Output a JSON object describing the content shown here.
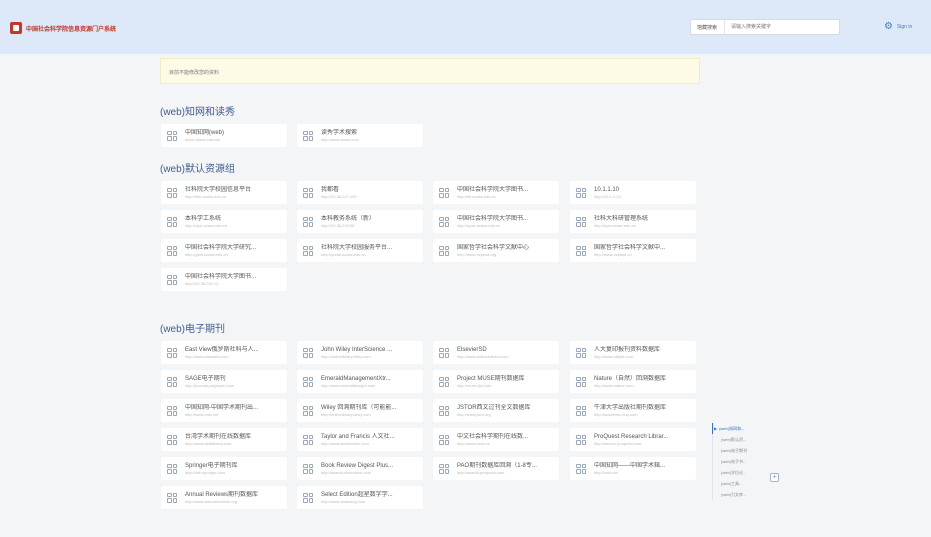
{
  "header": {
    "logo_text": "中国社会科学院信息资源门户系统",
    "search": {
      "scope_label": "馆藏搜索",
      "placeholder": "请输入搜索关键字"
    },
    "user_label": "Sign in"
  },
  "notice": "目前不能修改您的资料",
  "sections": [
    {
      "title": "(web)知网和读秀",
      "items": [
        {
          "name": "中国知网(web)",
          "url": "https://www.cnki.net"
        },
        {
          "name": "读秀学术搜索",
          "url": "http://www.duxiu.com"
        }
      ]
    },
    {
      "title": "(web)默认资源组",
      "items": [
        {
          "name": "社科院大学校园信息平台",
          "url": "http://info.ucass.edu.cn"
        },
        {
          "name": "我都看",
          "url": "http://10.38.247.192"
        },
        {
          "name": "中国社会科学院大学图书...",
          "url": "http://lib.ucass.edu.cn"
        },
        {
          "name": "10.1.1.10",
          "url": "http://10.1.1.10"
        },
        {
          "name": "本科学工系统",
          "url": "http://xgxt.ucass.edu.cn"
        },
        {
          "name": "本科教务系统（新）",
          "url": "http://10.38.220.58"
        },
        {
          "name": "中国社会科学院大学图书...",
          "url": "http://opac.ucass.edu.cn"
        },
        {
          "name": "社科大科研管理系统",
          "url": "http://kyxt.ucass.edu.cn"
        },
        {
          "name": "中国社会科学院大学研究...",
          "url": "http://yjsxt.ucass.edu.cn"
        },
        {
          "name": "社科院大学校园服务平台...",
          "url": "http://portal.ucass.edu.cn"
        },
        {
          "name": "国家哲学社会科学文献中心",
          "url": "http://www.ncpssd.org"
        },
        {
          "name": "国家哲学社会科学文献中...",
          "url": "http://www.ncpssd.cn"
        },
        {
          "name": "中国社会科学院大学图书...",
          "url": "http://10.38.240.12"
        }
      ]
    },
    {
      "title": "(web)电子期刊",
      "items": [
        {
          "name": "East View俄罗斯社科与人...",
          "url": "http://www.eastview.com"
        },
        {
          "name": "John Wiley InterScience ...",
          "url": "http://onlinelibrary.wiley.com"
        },
        {
          "name": "ElsevierSD",
          "url": "http://www.sciencedirect.com"
        },
        {
          "name": "人大复印报刊资料数据库",
          "url": "http://www.rdfybk.com"
        },
        {
          "name": "SAGE电子期刊",
          "url": "http://journals.sagepub.com"
        },
        {
          "name": "EmeraldManagementXtr...",
          "url": "http://www.emeraldinsight.com"
        },
        {
          "name": "Project MUSE期刊数据库",
          "url": "http://muse.jhu.edu"
        },
        {
          "name": "Nature（自然）回溯数据库",
          "url": "http://www.nature.com"
        },
        {
          "name": "中国知网-中国学术期刊出...",
          "url": "http://www.cnki.net"
        },
        {
          "name": "Wiley 回溯期刊库（可能能...",
          "url": "http://onlinelibrary.wiley.com"
        },
        {
          "name": "JSTOR西文过刊全文数据库",
          "url": "http://www.jstor.org"
        },
        {
          "name": "牛津大学出版社期刊数据库",
          "url": "http://academic.oup.com"
        },
        {
          "name": "台湾学术期刊在线数据库",
          "url": "http://www.airitilibrary.com"
        },
        {
          "name": "Taylor and Francis 人文社...",
          "url": "http://www.tandfonline.com"
        },
        {
          "name": "中文社会科学期刊在线数...",
          "url": "http://www.cssn.cn"
        },
        {
          "name": "ProQuest Research Librar...",
          "url": "http://search.proquest.com"
        },
        {
          "name": "Springer电子期刊库",
          "url": "http://link.springer.com"
        },
        {
          "name": "Book Review Digest Plus...",
          "url": "http://search.ebscohost.com"
        },
        {
          "name": "PAO期刊数据库回溯（1-8专...",
          "url": "http://search.proquest.com"
        },
        {
          "name": "中国知网——中国学术辑...",
          "url": "http://cnki.net"
        },
        {
          "name": "Annual Reviews期刊数据库",
          "url": "http://www.annualreviews.org"
        },
        {
          "name": "Select Edition超星数字学...",
          "url": "http://www.chaoxing.com"
        }
      ]
    }
  ],
  "anchor_nav": [
    "(web)知网和...",
    "(web)默认资...",
    "(web)电子期刊",
    "(web)电子书...",
    "(web)学位论...",
    "(web)工具...",
    "(web)引文库..."
  ],
  "colors": {
    "header_bg": "#dde9f8",
    "accent": "#3d5d8f",
    "notice_bg": "#fdfbe6",
    "logo_red": "#c0392b"
  }
}
